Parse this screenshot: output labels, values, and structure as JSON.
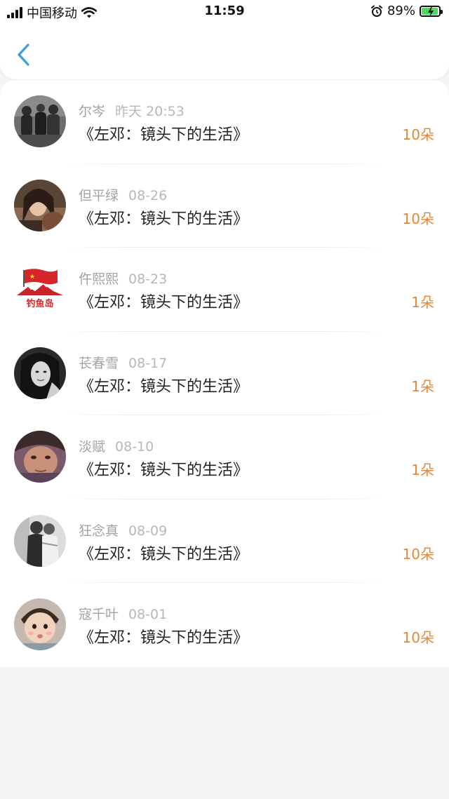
{
  "status_bar": {
    "carrier": "中国移动",
    "time": "11:59",
    "battery": "89%"
  },
  "header": {
    "back_icon": "chevron-left-icon"
  },
  "list": [
    {
      "name": "尔岑",
      "date": "昨天 20:53",
      "title": "《左邓：镜头下的生活》",
      "amount": "10朵",
      "avatar": "group-photo"
    },
    {
      "name": "但平绿",
      "date": "08-26",
      "title": "《左邓：镜头下的生活》",
      "amount": "10朵",
      "avatar": "woman-portrait"
    },
    {
      "name": "仵熙熙",
      "date": "08-23",
      "title": "《左邓：镜头下的生活》",
      "amount": "1朵",
      "avatar": "flag-logo",
      "avatar_text": "钓鱼岛"
    },
    {
      "name": "苌春雪",
      "date": "08-17",
      "title": "《左邓：镜头下的生活》",
      "amount": "1朵",
      "avatar": "bw-portrait"
    },
    {
      "name": "淡赋",
      "date": "08-10",
      "title": "《左邓：镜头下的生活》",
      "amount": "1朵",
      "avatar": "face-closeup"
    },
    {
      "name": "狂念真",
      "date": "08-09",
      "title": "《左邓：镜头下的生活》",
      "amount": "10朵",
      "avatar": "couple-bw"
    },
    {
      "name": "寇千叶",
      "date": "08-01",
      "title": "《左邓：镜头下的生活》",
      "amount": "10朵",
      "avatar": "child-photo"
    }
  ],
  "colors": {
    "accent": "#3a9de0",
    "amount": "#e3873a",
    "battery": "#4cd964"
  }
}
